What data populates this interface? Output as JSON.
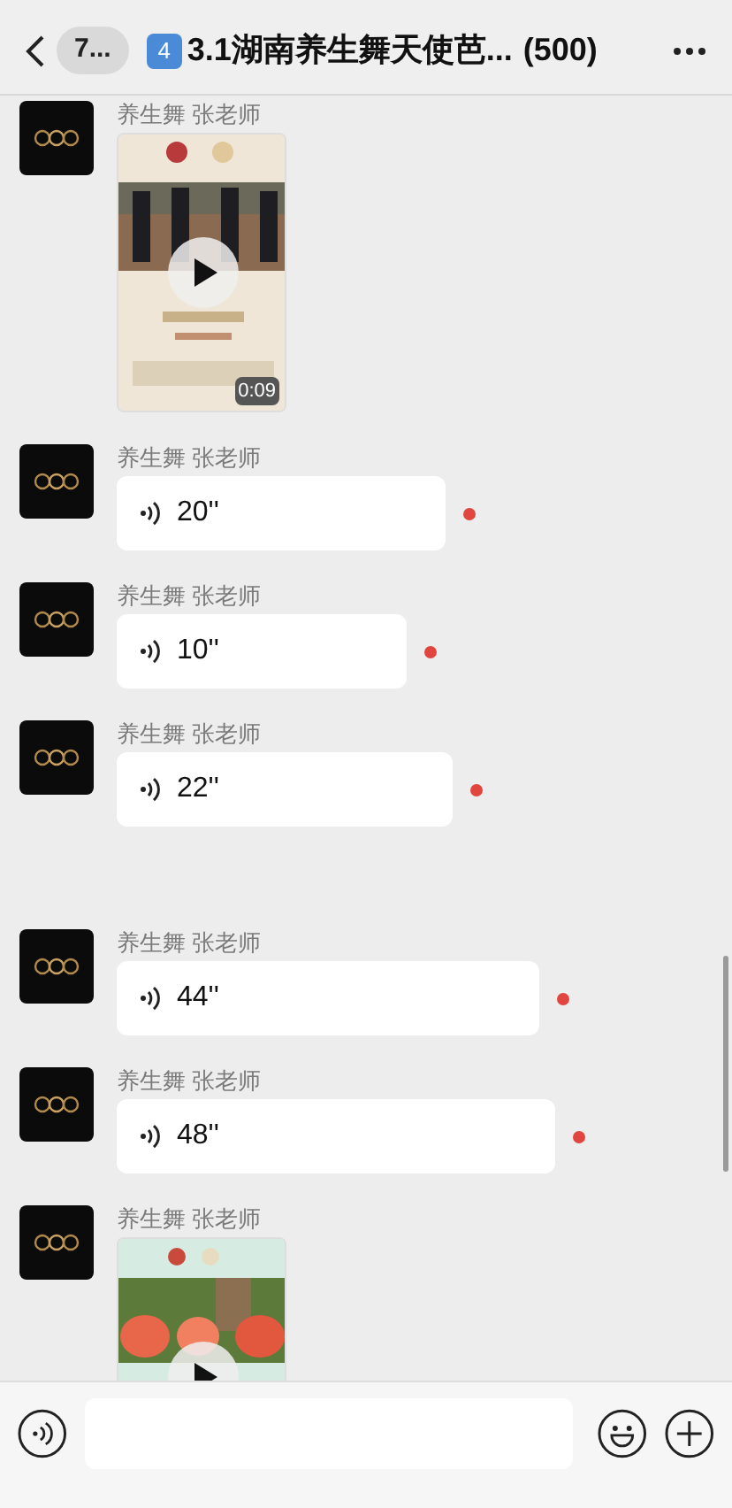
{
  "header": {
    "back_badge": "7...",
    "title_emoji": "4",
    "title": "3.1湖南养生舞天使芭...",
    "count": "(500)"
  },
  "messages": [
    {
      "kind": "video",
      "sender": "养生舞 张老师",
      "duration": "0:09"
    },
    {
      "kind": "voice",
      "sender": "养生舞 张老师",
      "duration": "20''",
      "unread": true
    },
    {
      "kind": "voice",
      "sender": "养生舞 张老师",
      "duration": "10''",
      "unread": true
    },
    {
      "kind": "voice",
      "sender": "养生舞 张老师",
      "duration": "22''",
      "unread": true
    },
    {
      "kind": "voice",
      "sender": "养生舞 张老师",
      "duration": "44''",
      "unread": true
    },
    {
      "kind": "voice",
      "sender": "养生舞 张老师",
      "duration": "48''",
      "unread": true
    },
    {
      "kind": "video",
      "sender": "养生舞 张老师"
    }
  ]
}
